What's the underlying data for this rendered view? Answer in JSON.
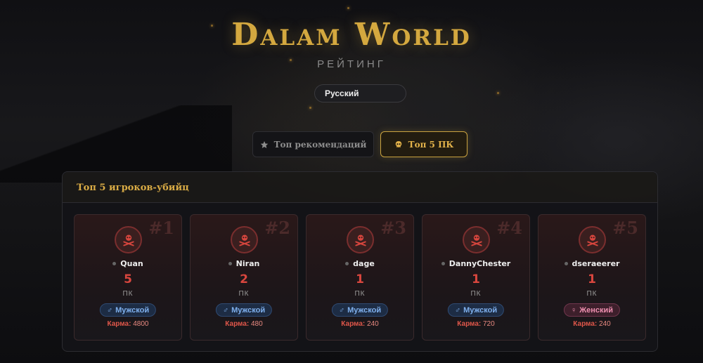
{
  "header": {
    "title": "Dalam World",
    "subtitle": "РЕЙТИНГ"
  },
  "language": {
    "selected": "Русский"
  },
  "tabs": [
    {
      "label": "Топ рекомендаций",
      "icon": "star-icon",
      "active": false
    },
    {
      "label": "Топ 5 ПК",
      "icon": "skull-icon",
      "active": true
    }
  ],
  "panel": {
    "title": "Топ 5 игроков-убийц"
  },
  "players": [
    {
      "rank": "#1",
      "name": "Quan",
      "pk": "5",
      "pk_label": "ПК",
      "gender": "Мужской",
      "gender_type": "male",
      "karma_label": "Карма:",
      "karma": "4800"
    },
    {
      "rank": "#2",
      "name": "Niran",
      "pk": "2",
      "pk_label": "ПК",
      "gender": "Мужской",
      "gender_type": "male",
      "karma_label": "Карма:",
      "karma": "480"
    },
    {
      "rank": "#3",
      "name": "dage",
      "pk": "1",
      "pk_label": "ПК",
      "gender": "Мужской",
      "gender_type": "male",
      "karma_label": "Карма:",
      "karma": "240"
    },
    {
      "rank": "#4",
      "name": "DannyChester",
      "pk": "1",
      "pk_label": "ПК",
      "gender": "Мужской",
      "gender_type": "male",
      "karma_label": "Карма:",
      "karma": "720"
    },
    {
      "rank": "#5",
      "name": "dseraeerer",
      "pk": "1",
      "pk_label": "ПК",
      "gender": "Женский",
      "gender_type": "female",
      "karma_label": "Карма:",
      "karma": "240"
    }
  ],
  "colors": {
    "accent_gold": "#d4a83f",
    "pk_red": "#d9463e",
    "male_blue": "#7fb0ee",
    "female_pink": "#ee8fb0"
  }
}
